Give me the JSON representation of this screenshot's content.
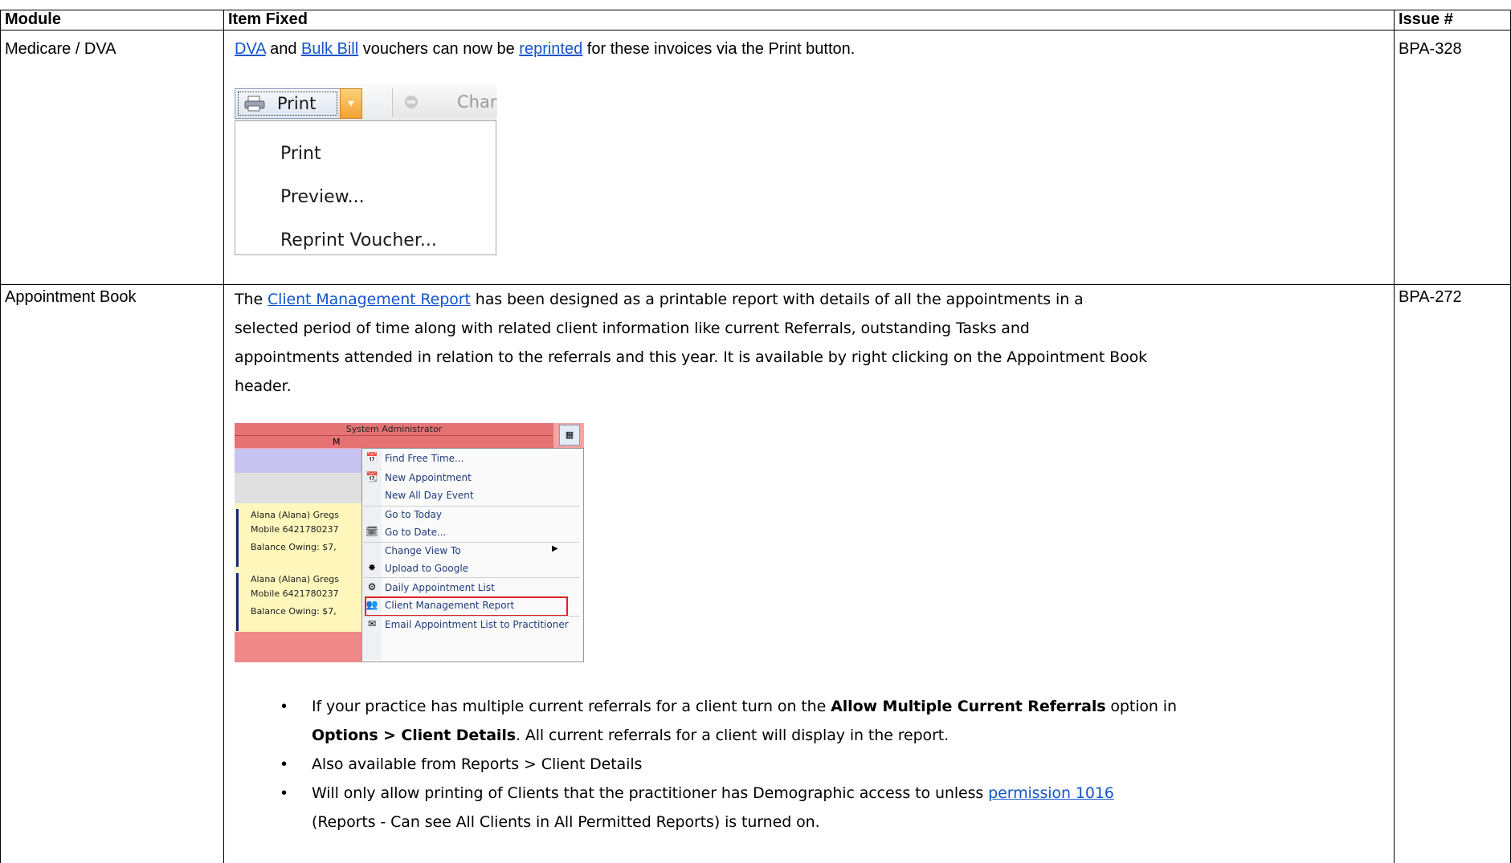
{
  "table": {
    "headers": [
      "Module",
      "Item Fixed",
      "Issue #"
    ]
  },
  "row1": {
    "module": "Medicare / DVA",
    "issue": "BPA-328",
    "text_parts": [
      "DVA",
      " and ",
      "Bulk Bill",
      " vouchers can now be ",
      "reprinted",
      " for these invoices via the Print button."
    ],
    "print_menu": {
      "print_button": "Print",
      "chart_tab": "Char",
      "items": [
        "Print",
        "Preview...",
        "Reprint Voucher..."
      ]
    }
  },
  "row2": {
    "module": "Appointment Book",
    "issue": "BPA-272",
    "para": {
      "prefix": "The ",
      "link": "Client Management Report",
      "rest1": " has been designed as a printable report with details of all the appointments in a",
      "line2": "selected period of time along with related client information like current Referrals, outstanding Tasks and",
      "line3": "appointments attended in relation to the referrals and this year. It is available by right clicking on the Appointment Book",
      "line4": "header."
    },
    "context_menu": {
      "header": "System Administrator",
      "header2": "M",
      "appts": [
        {
          "name": "Alana (Alana) Gregs",
          "mobile": "Mobile 6421780237",
          "balance": "Balance Owing: $7,"
        },
        {
          "name": "Alana (Alana) Gregs",
          "mobile": "Mobile 6421780237",
          "balance": "Balance Owing: $7,"
        }
      ],
      "items": [
        "Find Free Time...",
        "New Appointment",
        "New All Day Event",
        "Go to Today",
        "Go to Date...",
        "Change View To",
        "Upload to Google",
        "Daily Appointment List",
        "Client Management Report",
        "Email Appointment List to Practitioner"
      ]
    },
    "bullets": {
      "b1_a": "If your practice has multiple current referrals for a client turn on the ",
      "b1_b": "Allow Multiple Current Referrals",
      "b1_c": " option in",
      "b1_d": "Options > Client Details",
      "b1_e": ". All current referrals for a client will display in the report.",
      "b2": "Also available from Reports > Client Details",
      "b3_a": "Will only allow printing of Clients that the practitioner has Demographic access to unless ",
      "b3_link": "permission 1016",
      "b3_b": "(Reports - Can see All Clients in All Permitted Reports) is turned on."
    }
  },
  "colors": {
    "link": "#1155cc",
    "highlight_border": "#e02020",
    "appt_bg": "#fffccc",
    "header_bg": "#e57373"
  }
}
